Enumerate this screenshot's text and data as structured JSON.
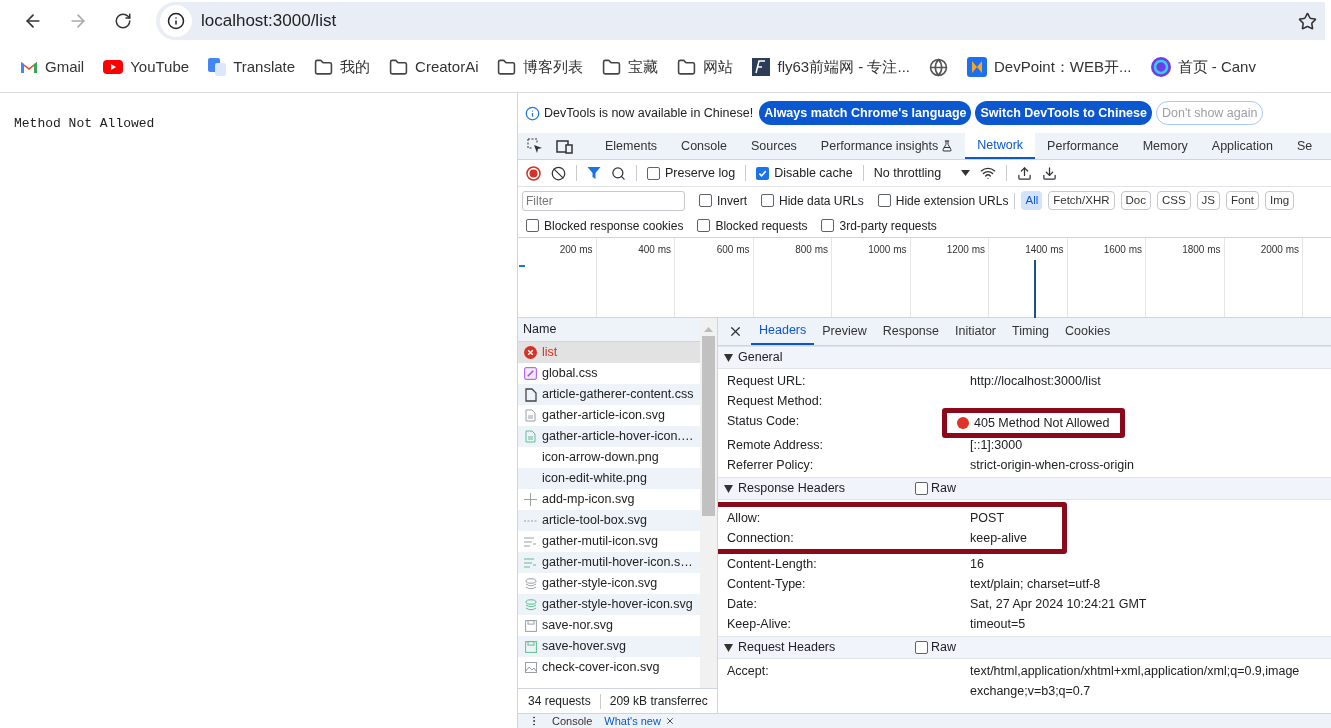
{
  "browser": {
    "address": "localhost:3000/list",
    "bookmarks": [
      {
        "label": "Gmail",
        "kind": "gmail"
      },
      {
        "label": "YouTube",
        "kind": "youtube"
      },
      {
        "label": "Translate",
        "kind": "translate"
      },
      {
        "label": "我的",
        "kind": "folder"
      },
      {
        "label": "CreatorAi",
        "kind": "folder"
      },
      {
        "label": "博客列表",
        "kind": "folder"
      },
      {
        "label": "宝藏",
        "kind": "folder"
      },
      {
        "label": "网站",
        "kind": "folder"
      },
      {
        "label": "fly63前端网 - 专注...",
        "kind": "fly"
      },
      {
        "kind": "globe"
      },
      {
        "label": "DevPoint：WEB开...",
        "kind": "devpoint"
      },
      {
        "label": "首页 - Canv",
        "kind": "canva"
      }
    ]
  },
  "page": {
    "text": "Method Not Allowed"
  },
  "devtools": {
    "infobar": {
      "message": "DevTools is now available in Chinese!",
      "buttons": [
        {
          "label": "Always match Chrome's language",
          "kind": "primary"
        },
        {
          "label": "Switch DevTools to Chinese",
          "kind": "primary"
        },
        {
          "label": "Don't show again",
          "kind": "secondary"
        }
      ]
    },
    "tabs": [
      {
        "label": "Elements",
        "selected": false
      },
      {
        "label": "Console",
        "selected": false
      },
      {
        "label": "Sources",
        "selected": false
      },
      {
        "label": "Performance insights",
        "selected": false,
        "kind": "experiment"
      },
      {
        "label": "Network",
        "selected": true
      },
      {
        "label": "Performance",
        "selected": false
      },
      {
        "label": "Memory",
        "selected": false
      },
      {
        "label": "Application",
        "selected": false
      },
      {
        "label": "Se",
        "selected": false
      }
    ],
    "toolbar": {
      "checks": [
        {
          "label": "Preserve log",
          "checked": false
        },
        {
          "label": "Disable cache",
          "checked": true
        }
      ],
      "throttling": "No throttling"
    },
    "filter": {
      "placeholder": "Filter",
      "checks": [
        {
          "label": "Invert",
          "checked": false
        },
        {
          "label": "Hide data URLs",
          "checked": false
        },
        {
          "label": "Hide extension URLs",
          "checked": false
        }
      ],
      "types": [
        {
          "label": "All",
          "selected": true
        },
        {
          "label": "Fetch/XHR",
          "selected": false
        },
        {
          "label": "Doc",
          "selected": false
        },
        {
          "label": "CSS",
          "selected": false
        },
        {
          "label": "JS",
          "selected": false
        },
        {
          "label": "Font",
          "selected": false
        },
        {
          "label": "Img",
          "selected": false
        }
      ]
    },
    "more_checks": [
      {
        "label": "Blocked response cookies",
        "checked": false
      },
      {
        "label": "Blocked requests",
        "checked": false
      },
      {
        "label": "3rd-party requests",
        "checked": false
      }
    ],
    "timeline": {
      "ticks": [
        "200 ms",
        "400 ms",
        "600 ms",
        "800 ms",
        "1000 ms",
        "1200 ms",
        "1400 ms",
        "1600 ms",
        "1800 ms",
        "2000 ms"
      ]
    },
    "requests": {
      "column": "Name",
      "rows": [
        {
          "name": "list",
          "kind": "error",
          "selected": true
        },
        {
          "name": "global.css",
          "kind": "css",
          "selected": false
        },
        {
          "name": "article-gatherer-content.css",
          "kind": "doc",
          "selected": false
        },
        {
          "name": "gather-article-icon.svg",
          "kind": "file",
          "selected": false
        },
        {
          "name": "gather-article-hover-icon.…",
          "kind": "file-green",
          "selected": false
        },
        {
          "name": "icon-arrow-down.png",
          "kind": "blank",
          "selected": false
        },
        {
          "name": "icon-edit-white.png",
          "kind": "blank",
          "selected": false
        },
        {
          "name": "add-mp-icon.svg",
          "kind": "plus",
          "selected": false
        },
        {
          "name": "article-tool-box.svg",
          "kind": "dash",
          "selected": false
        },
        {
          "name": "gather-mutil-icon.svg",
          "kind": "lines",
          "selected": false
        },
        {
          "name": "gather-mutil-hover-icon.s…",
          "kind": "lines-green",
          "selected": false
        },
        {
          "name": "gather-style-icon.svg",
          "kind": "stack",
          "selected": false
        },
        {
          "name": "gather-style-hover-icon.svg",
          "kind": "stack-green",
          "selected": false
        },
        {
          "name": "save-nor.svg",
          "kind": "save",
          "selected": false
        },
        {
          "name": "save-hover.svg",
          "kind": "save-green",
          "selected": false
        },
        {
          "name": "check-cover-icon.svg",
          "kind": "image",
          "selected": false
        }
      ]
    },
    "status": {
      "count": "34 requests",
      "transferred": "209 kB transferrec"
    },
    "details": {
      "tabs": [
        {
          "label": "Headers",
          "selected": true
        },
        {
          "label": "Preview",
          "selected": false
        },
        {
          "label": "Response",
          "selected": false
        },
        {
          "label": "Initiator",
          "selected": false
        },
        {
          "label": "Timing",
          "selected": false
        },
        {
          "label": "Cookies",
          "selected": false
        }
      ],
      "sections": [
        {
          "title": "General",
          "rows": [
            {
              "name": "Request URL:",
              "value": "http://localhost:3000/list"
            },
            {
              "name": "Request Method:"
            },
            {
              "name": "Status Code:",
              "value": "405 Method Not Allowed",
              "color": "#e0342a",
              "framed": true
            },
            {
              "name": "Remote Address:",
              "value": "[::1]:3000"
            },
            {
              "name": "Referrer Policy:",
              "value": "strict-origin-when-cross-origin"
            }
          ]
        },
        {
          "title": "Response Headers",
          "raw": {
            "label": "Raw",
            "checked": false
          },
          "rows": [
            {
              "kind": "framed_group",
              "rows": [
                {
                  "name": "Allow:",
                  "value": "POST"
                },
                {
                  "name": "Connection:",
                  "value": "keep-alive"
                }
              ]
            },
            {
              "name": "Content-Length:",
              "value": "16"
            },
            {
              "name": "Content-Type:",
              "value": "text/plain; charset=utf-8"
            },
            {
              "name": "Date:",
              "value": "Sat, 27 Apr 2024 10:24:21 GMT"
            },
            {
              "name": "Keep-Alive:",
              "value": "timeout=5"
            }
          ]
        },
        {
          "title": "Request Headers",
          "raw": {
            "label": "Raw",
            "checked": false
          },
          "rows": [
            {
              "name": "Accept:",
              "value_lines": [
                "text/html,application/xhtml+xml,application/xml;q=0.9,image",
                "exchange;v=b3;q=0.7"
              ]
            }
          ]
        }
      ]
    },
    "drawer": {
      "tabs": [
        {
          "label": "Console",
          "selected": false
        },
        {
          "label": "What's new",
          "selected": true
        }
      ]
    }
  }
}
